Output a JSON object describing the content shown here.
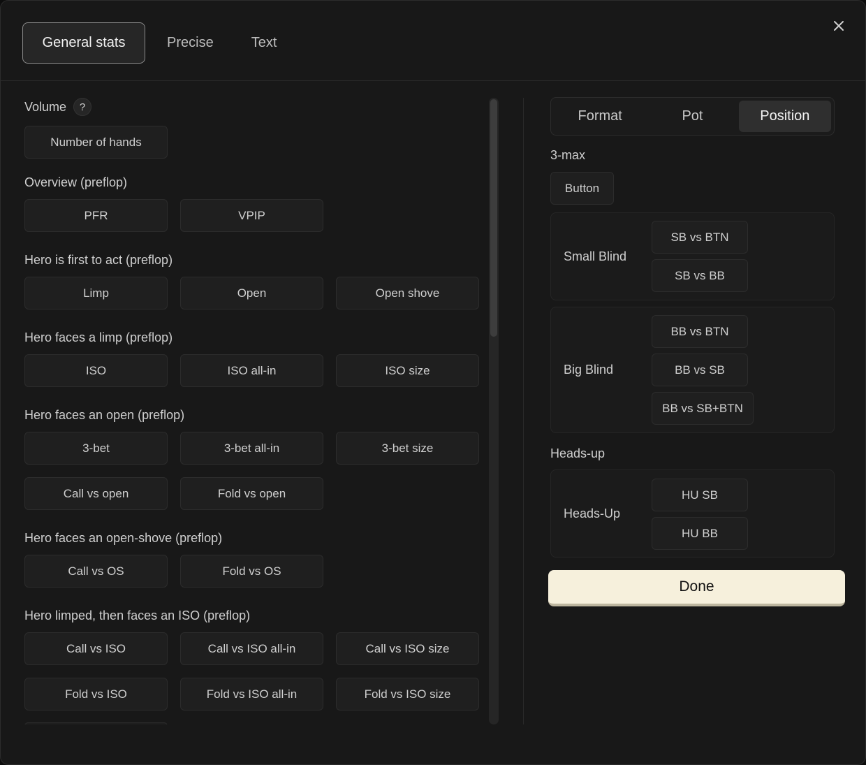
{
  "top_tabs": [
    "General stats",
    "Precise",
    "Text"
  ],
  "left": {
    "volume": {
      "title": "Volume",
      "help": "?",
      "buttons": [
        "Number of hands"
      ]
    },
    "sections": [
      {
        "title": "Overview (preflop)",
        "rows": [
          [
            "PFR",
            "VPIP"
          ]
        ]
      },
      {
        "title": "Hero is first to act (preflop)",
        "rows": [
          [
            "Limp",
            "Open",
            "Open shove"
          ]
        ]
      },
      {
        "title": "Hero faces a limp (preflop)",
        "rows": [
          [
            "ISO",
            "ISO all-in",
            "ISO size"
          ]
        ]
      },
      {
        "title": "Hero faces an open (preflop)",
        "rows": [
          [
            "3-bet",
            "3-bet all-in",
            "3-bet size"
          ],
          [
            "Call vs open",
            "Fold vs open"
          ]
        ]
      },
      {
        "title": "Hero faces an open-shove (preflop)",
        "rows": [
          [
            "Call vs OS",
            "Fold vs OS"
          ]
        ]
      },
      {
        "title": "Hero limped, then faces an ISO (preflop)",
        "rows": [
          [
            "Call vs ISO",
            "Call vs ISO all-in",
            "Call vs ISO size"
          ],
          [
            "Fold vs ISO",
            "Fold vs ISO all-in",
            "Fold vs ISO size"
          ]
        ]
      }
    ]
  },
  "right": {
    "segments": [
      "Format",
      "Pot",
      "Position"
    ],
    "active_segment": "Position",
    "three_max_label": "3-max",
    "button_label": "Button",
    "small_blind": {
      "label": "Small Blind",
      "buttons": [
        "SB vs BTN",
        "SB vs BB"
      ]
    },
    "big_blind": {
      "label": "Big Blind",
      "buttons": [
        "BB vs BTN",
        "BB vs SB",
        "BB vs SB+BTN"
      ]
    },
    "heads_up_label": "Heads-up",
    "heads_up": {
      "label": "Heads-Up",
      "buttons": [
        "HU SB",
        "HU BB"
      ]
    }
  },
  "done_label": "Done"
}
